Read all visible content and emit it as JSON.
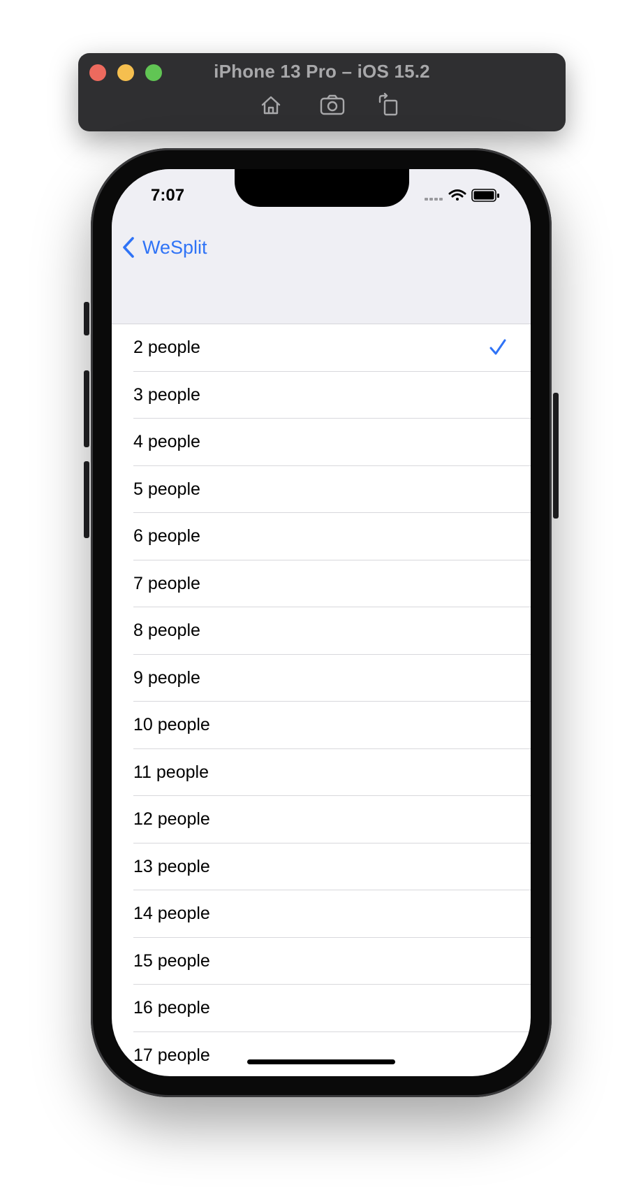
{
  "simulator": {
    "title": "iPhone 13 Pro – iOS 15.2",
    "tools": [
      "home-icon",
      "screenshot-icon",
      "rotate-icon"
    ]
  },
  "status_bar": {
    "time": "7:07"
  },
  "nav": {
    "back_label": "WeSplit"
  },
  "picker": {
    "selected": "2 people",
    "items": [
      "2 people",
      "3 people",
      "4 people",
      "5 people",
      "6 people",
      "7 people",
      "8 people",
      "9 people",
      "10 people",
      "11 people",
      "12 people",
      "13 people",
      "14 people",
      "15 people",
      "16 people",
      "17 people"
    ]
  },
  "colors": {
    "accent": "#2f73f6",
    "nav_background": "#efeff4"
  }
}
